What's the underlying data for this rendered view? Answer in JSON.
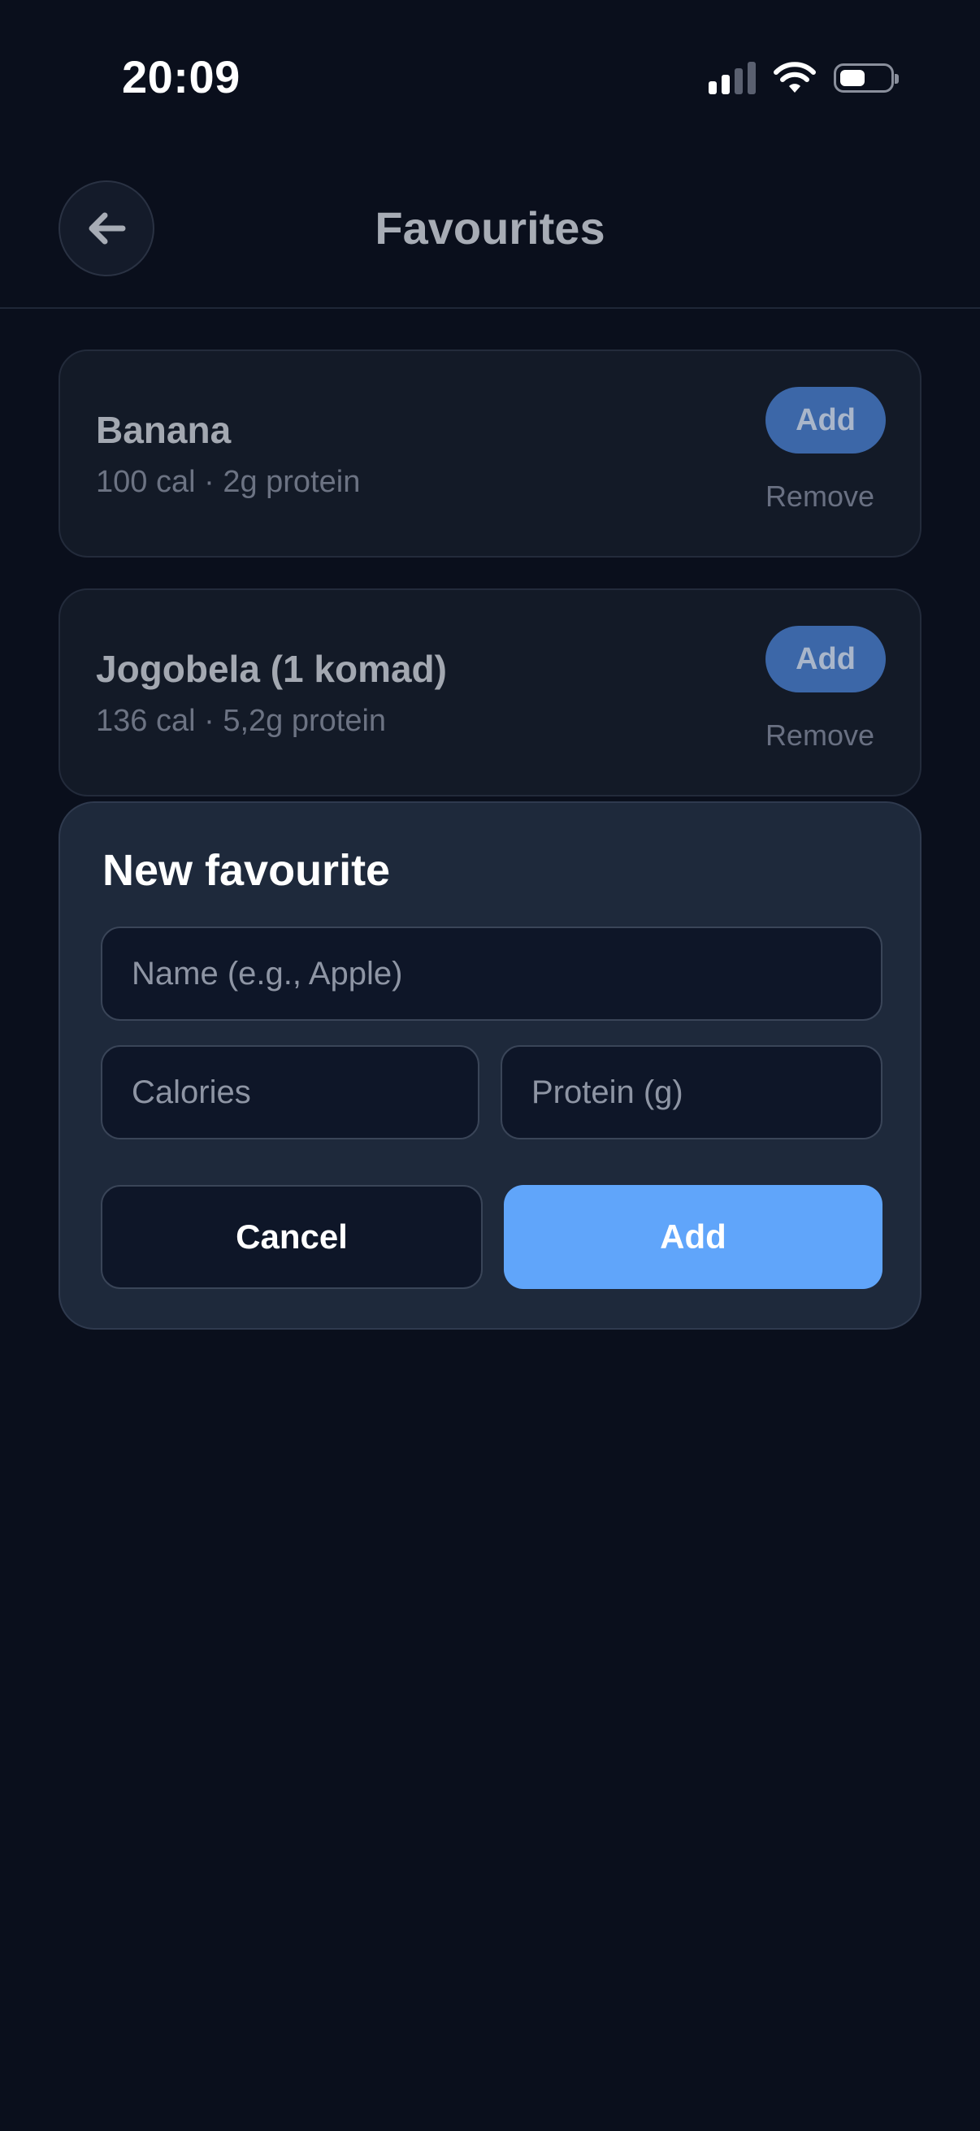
{
  "status_bar": {
    "time": "20:09",
    "icons": [
      "cellular-signal-icon",
      "wifi-icon",
      "battery-icon"
    ]
  },
  "header": {
    "title": "Favourites",
    "back_icon": "arrow-left-icon"
  },
  "favourites": [
    {
      "name": "Banana",
      "calories": "100 cal",
      "protein": "· 2g protein",
      "add_label": "Add",
      "remove_label": "Remove"
    },
    {
      "name": "Jogobela (1 komad)",
      "calories": "136 cal",
      "protein": "· 5,2g protein",
      "add_label": "Add",
      "remove_label": "Remove"
    }
  ],
  "new_favourite": {
    "title": "New favourite",
    "name_placeholder": "Name (e.g., Apple)",
    "calories_placeholder": "Calories",
    "protein_placeholder": "Protein (g)",
    "cancel_label": "Cancel",
    "add_label": "Add"
  },
  "colors": {
    "background": "#0a0f1c",
    "card": "#131a27",
    "sheet": "#1e293b",
    "accent": "#60a5fa",
    "accent_dim": "#3c67a8"
  }
}
